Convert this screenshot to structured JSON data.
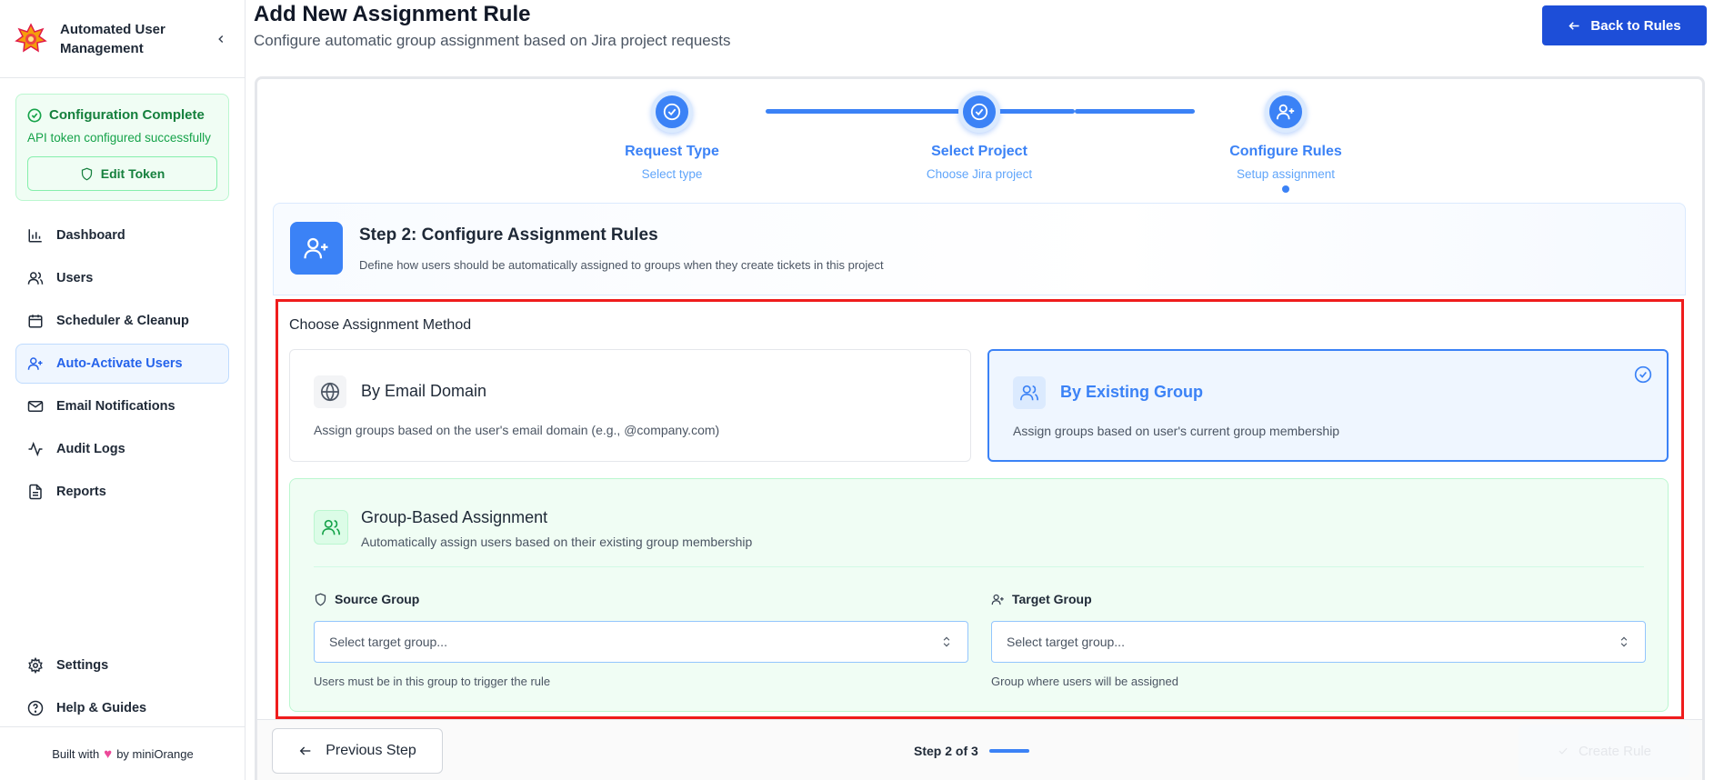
{
  "sidebar": {
    "brand_name": "Automated User Management",
    "config": {
      "title": "Configuration Complete",
      "subtitle": "API token configured successfully",
      "edit_label": "Edit Token"
    },
    "nav": [
      {
        "label": "Dashboard",
        "icon": "bar-chart-icon"
      },
      {
        "label": "Users",
        "icon": "users-icon"
      },
      {
        "label": "Scheduler & Cleanup",
        "icon": "calendar-icon"
      },
      {
        "label": "Auto-Activate Users",
        "icon": "user-plus-icon",
        "active": true
      },
      {
        "label": "Email Notifications",
        "icon": "mail-icon"
      },
      {
        "label": "Audit Logs",
        "icon": "activity-icon"
      },
      {
        "label": "Reports",
        "icon": "file-text-icon"
      }
    ],
    "nav_bottom": [
      {
        "label": "Settings",
        "icon": "gear-icon"
      },
      {
        "label": "Help & Guides",
        "icon": "help-circle-icon"
      }
    ],
    "footer": {
      "prefix": "Built with",
      "suffix": "by miniOrange"
    }
  },
  "header": {
    "title": "Add New Assignment Rule",
    "subtitle": "Configure automatic group assignment based on Jira project requests",
    "back_label": "Back to Rules"
  },
  "stepper": {
    "steps": [
      {
        "label": "Request Type",
        "sub": "Select type",
        "state": "done"
      },
      {
        "label": "Select Project",
        "sub": "Choose Jira project",
        "state": "done"
      },
      {
        "label": "Configure Rules",
        "sub": "Setup assignment",
        "state": "current"
      }
    ]
  },
  "step_card": {
    "title": "Step 2: Configure Assignment Rules",
    "description": "Define how users should be automatically assigned to groups when they create tickets in this project"
  },
  "method": {
    "title": "Choose Assignment Method",
    "options": [
      {
        "title": "By Email Domain",
        "description": "Assign groups based on the user's email domain (e.g., @company.com)",
        "selected": false
      },
      {
        "title": "By Existing Group",
        "description": "Assign groups based on user's current group membership",
        "selected": true
      }
    ]
  },
  "assignment": {
    "title": "Group-Based Assignment",
    "subtitle": "Automatically assign users based on their existing group membership",
    "source": {
      "label": "Source Group",
      "placeholder": "Select target group...",
      "help": "Users must be in this group to trigger the rule"
    },
    "target": {
      "label": "Target Group",
      "placeholder": "Select target group...",
      "help": "Group where users will be assigned"
    }
  },
  "footer_bar": {
    "prev_label": "Previous Step",
    "step_text": "Step 2 of 3",
    "create_label": "Create Rule"
  },
  "colors": {
    "primary": "#3b82f6",
    "primary_dark": "#1d4ed8",
    "success": "#15803d",
    "highlight": "#ef1c1c"
  }
}
